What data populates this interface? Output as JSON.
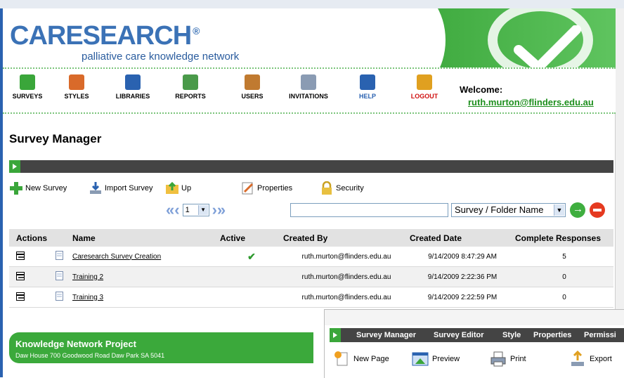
{
  "header": {
    "logo_text": "CARESEARCH",
    "logo_reg": "®",
    "tagline": "palliative care knowledge network"
  },
  "nav": [
    {
      "label": "SURVEYS",
      "icon": "surveys-icon",
      "color": "#3aa63a"
    },
    {
      "label": "STYLES",
      "icon": "styles-icon",
      "color": "#d96a2a"
    },
    {
      "label": "LIBRARIES",
      "icon": "libraries-icon",
      "color": "#2a62b0"
    },
    {
      "label": "REPORTS",
      "icon": "reports-icon",
      "color": "#4a9a4a"
    },
    {
      "label": "USERS",
      "icon": "users-icon",
      "color": "#c07a30"
    },
    {
      "label": "INVITATIONS",
      "icon": "invitations-icon",
      "color": "#8a9bb3"
    },
    {
      "label": "HELP",
      "icon": "help-icon",
      "color": "#2a62b0",
      "text_color": "#2a62b0"
    },
    {
      "label": "LOGOUT",
      "icon": "logout-icon",
      "color": "#e0a020",
      "text_color": "#d01010"
    }
  ],
  "welcome": {
    "label": "Welcome:",
    "email": "ruth.murton@flinders.edu.au"
  },
  "page_title": "Survey Manager",
  "toolbar": {
    "new_survey": "New Survey",
    "import_survey": "Import Survey",
    "up": "Up",
    "properties": "Properties",
    "security": "Security"
  },
  "pager": {
    "page": "1",
    "search_value": "",
    "search_field": "Survey / Folder Name"
  },
  "table": {
    "headers": [
      "Actions",
      "Name",
      "Active",
      "Created By",
      "Created Date",
      "Complete Responses"
    ],
    "rows": [
      {
        "name": "Caresearch Survey Creation",
        "active": "✔",
        "created_by": "ruth.murton@flinders.edu.au",
        "created_date": "9/14/2009 8:47:29 AM",
        "responses": "5"
      },
      {
        "name": "Training 2",
        "active": "",
        "created_by": "ruth.murton@flinders.edu.au",
        "created_date": "9/14/2009 2:22:36 PM",
        "responses": "0"
      },
      {
        "name": "Training 3",
        "active": "",
        "created_by": "ruth.murton@flinders.edu.au",
        "created_date": "9/14/2009 2:22:59 PM",
        "responses": "0"
      }
    ]
  },
  "footer": {
    "title": "Knowledge Network Project",
    "address": "Daw House 700 Goodwood Road Daw Park SA 5041"
  },
  "overlay": {
    "tabs": [
      "Survey Manager",
      "Survey Editor",
      "Style",
      "Properties",
      "Permissi"
    ],
    "tools": {
      "new_page": "New Page",
      "preview": "Preview",
      "print": "Print",
      "export": "Export"
    }
  },
  "colors": {
    "brand_green": "#3aa63a",
    "brand_blue": "#3b72b6",
    "link_green": "#1e8f1e"
  }
}
